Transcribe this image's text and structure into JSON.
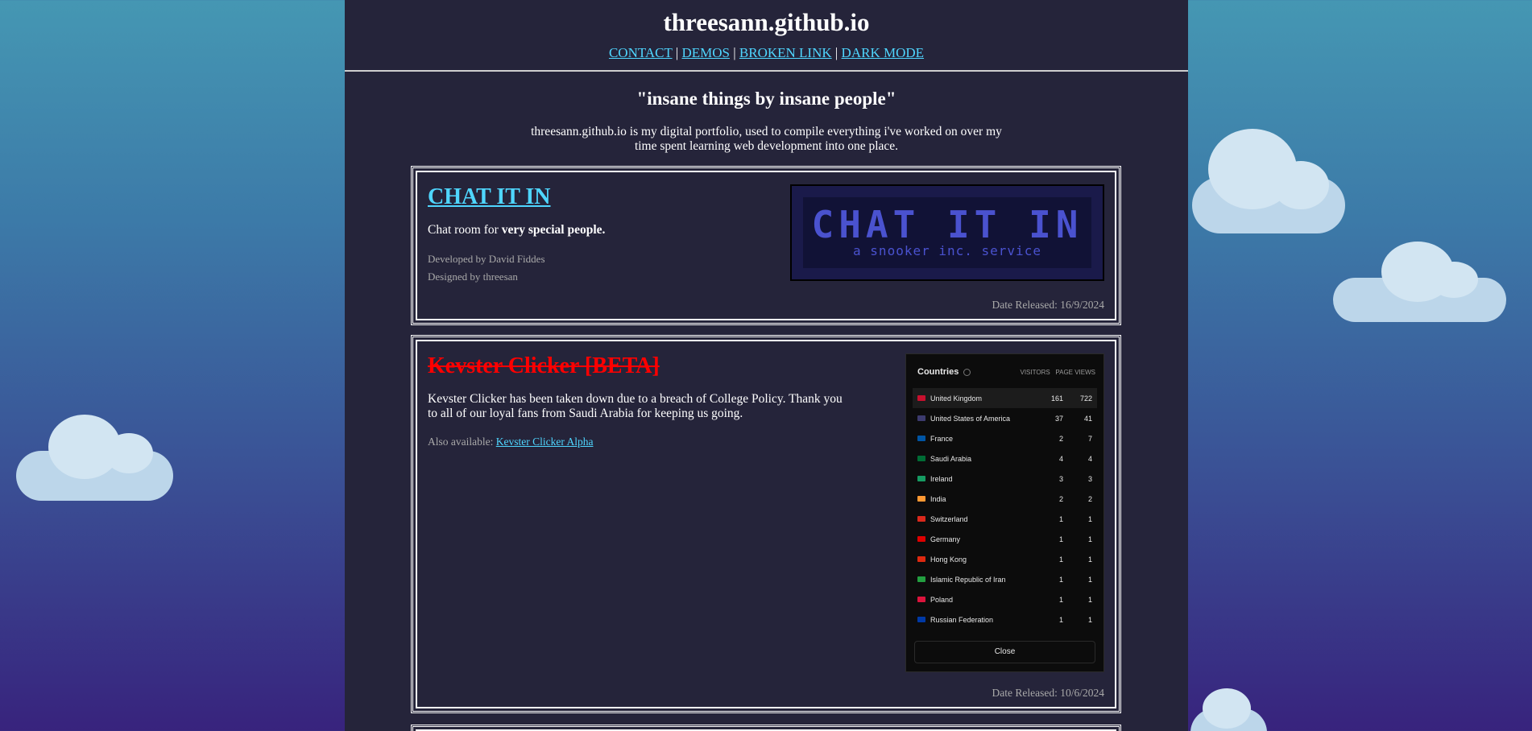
{
  "header": {
    "site_title": "threesann.github.io",
    "nav": [
      {
        "label": "CONTACT"
      },
      {
        "label": "DEMOS"
      },
      {
        "label": "BROKEN LINK"
      },
      {
        "label": "DARK MODE"
      }
    ],
    "separator": "|"
  },
  "intro": {
    "tagline": "\"insane things by insane people\"",
    "text": "threesann.github.io is my digital portfolio, used to compile everything i've worked on over my time spent learning web development into one place."
  },
  "projects": [
    {
      "title": "CHAT IT IN",
      "desc_plain": "Chat room for ",
      "desc_bold": "very special people.",
      "developed": "Developed by David Fiddes",
      "designed": "Designed by threesan",
      "date": "Date Released: 16/9/2024",
      "banner_title": "CHAT IT IN",
      "banner_sub": "a snooker inc. service"
    },
    {
      "title": "Kevster Clicker [BETA]",
      "desc": "Kevster Clicker has been taken down due to a breach of College Policy. Thank you to all of our loyal fans from Saudi Arabia for keeping us going.",
      "also_label": "Also available: ",
      "also_link": "Kevster Clicker Alpha",
      "date": "Date Released: 10/6/2024",
      "panel": {
        "title": "Countries",
        "col_visitors": "VISITORS",
        "col_pageviews": "PAGE VIEWS",
        "close": "Close",
        "rows": [
          {
            "country": "United Kingdom",
            "visitors": "161",
            "views": "722",
            "flag": "#c8102e"
          },
          {
            "country": "United States of America",
            "visitors": "37",
            "views": "41",
            "flag": "#3c3b6e"
          },
          {
            "country": "France",
            "visitors": "2",
            "views": "7",
            "flag": "#0055a4"
          },
          {
            "country": "Saudi Arabia",
            "visitors": "4",
            "views": "4",
            "flag": "#006c35"
          },
          {
            "country": "Ireland",
            "visitors": "3",
            "views": "3",
            "flag": "#169b62"
          },
          {
            "country": "India",
            "visitors": "2",
            "views": "2",
            "flag": "#ff9933"
          },
          {
            "country": "Switzerland",
            "visitors": "1",
            "views": "1",
            "flag": "#da291c"
          },
          {
            "country": "Germany",
            "visitors": "1",
            "views": "1",
            "flag": "#dd0000"
          },
          {
            "country": "Hong Kong",
            "visitors": "1",
            "views": "1",
            "flag": "#de2910"
          },
          {
            "country": "Islamic Republic of Iran",
            "visitors": "1",
            "views": "1",
            "flag": "#239f40"
          },
          {
            "country": "Poland",
            "visitors": "1",
            "views": "1",
            "flag": "#dc143c"
          },
          {
            "country": "Russian Federation",
            "visitors": "1",
            "views": "1",
            "flag": "#0039a6"
          }
        ]
      }
    }
  ],
  "colors": {
    "link": "#4fd6ff",
    "panel_bg": "#25243a",
    "dead_title": "#ff0000"
  }
}
